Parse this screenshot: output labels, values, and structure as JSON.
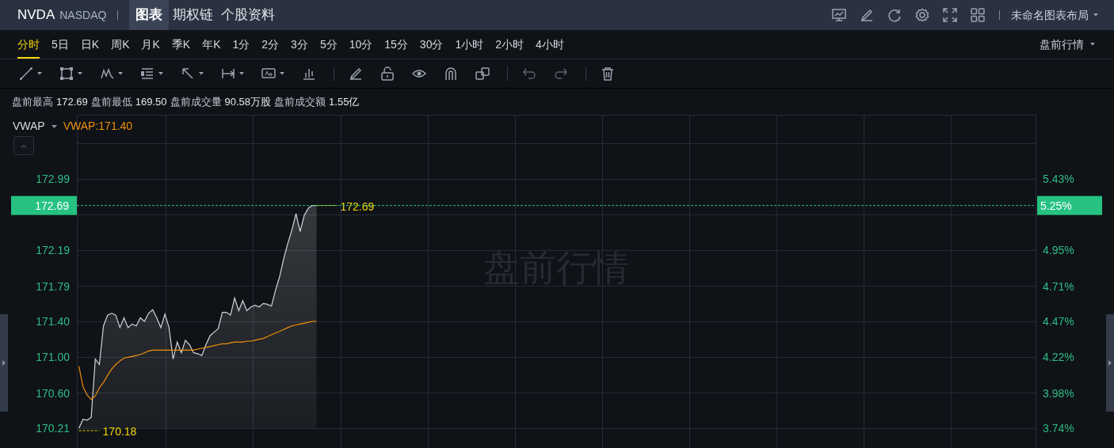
{
  "header": {
    "symbol": "NVDA",
    "exchange": "NASDAQ",
    "tabs": [
      {
        "label": "图表",
        "selected": true
      },
      {
        "label": "期权链",
        "selected": false
      },
      {
        "label": "个股资料",
        "selected": false
      }
    ],
    "layout_menu": "未命名图表布局"
  },
  "periods": [
    {
      "label": "分时",
      "selected": true
    },
    {
      "label": "5日",
      "selected": false
    },
    {
      "label": "日K",
      "selected": false
    },
    {
      "label": "周K",
      "selected": false
    },
    {
      "label": "月K",
      "selected": false
    },
    {
      "label": "季K",
      "selected": false
    },
    {
      "label": "年K",
      "selected": false
    },
    {
      "label": "1分",
      "selected": false
    },
    {
      "label": "2分",
      "selected": false
    },
    {
      "label": "3分",
      "selected": false
    },
    {
      "label": "5分",
      "selected": false
    },
    {
      "label": "10分",
      "selected": false
    },
    {
      "label": "15分",
      "selected": false
    },
    {
      "label": "30分",
      "selected": false
    },
    {
      "label": "1小时",
      "selected": false
    },
    {
      "label": "2小时",
      "selected": false
    },
    {
      "label": "4小时",
      "selected": false
    }
  ],
  "session_menu": "盘前行情",
  "stats": [
    {
      "label": "盘前最高",
      "value": "172.69"
    },
    {
      "label": "盘前最低",
      "value": "169.50"
    },
    {
      "label": "盘前成交量",
      "value": "90.58万股"
    },
    {
      "label": "盘前成交额",
      "value": "1.55亿"
    }
  ],
  "indicator": {
    "name": "VWAP",
    "reading": "VWAP:171.40"
  },
  "chart": {
    "watermark": "盘前行情",
    "current_change": "5.25%",
    "right_axis_labels": [
      "5.43%",
      "4.95%",
      "4.71%",
      "4.47%",
      "4.22%",
      "3.98%",
      "3.74%"
    ],
    "chart_data": {
      "type": "line",
      "grid": true,
      "ylim": [
        169.99,
        173.7
      ],
      "yticks": [
        {
          "value": 172.99,
          "label": "172.99"
        },
        {
          "value": 172.19,
          "label": "172.19"
        },
        {
          "value": 171.79,
          "label": "171.79"
        },
        {
          "value": 171.4,
          "label": "171.40"
        },
        {
          "value": 171.0,
          "label": "171.00"
        },
        {
          "value": 170.6,
          "label": "170.60"
        },
        {
          "value": 170.21,
          "label": "170.21"
        }
      ],
      "ref_lines": [
        {
          "axis": "y",
          "value": 172.69,
          "label": "172.69",
          "color": "#26c281"
        }
      ],
      "series": [
        {
          "type": "area",
          "color": "#d0d4da",
          "values": [
            170.21,
            170.31,
            170.3,
            170.33,
            170.98,
            170.92,
            171.35,
            171.47,
            171.49,
            171.47,
            171.33,
            171.44,
            171.33,
            171.37,
            171.35,
            171.44,
            171.4,
            171.49,
            171.53,
            171.44,
            171.33,
            171.48,
            171.33,
            170.98,
            171.17,
            171.05,
            171.19,
            171.14,
            171.05,
            171.04,
            171.02,
            171.14,
            171.24,
            171.28,
            171.32,
            171.5,
            171.5,
            171.47,
            171.66,
            171.52,
            171.63,
            171.52,
            171.56,
            171.58,
            171.56,
            171.6,
            171.59,
            171.57,
            171.75,
            171.9,
            172.1,
            172.27,
            172.42,
            172.6,
            172.4,
            172.58,
            172.66,
            172.69,
            172.69,
            null,
            null,
            null,
            null,
            null,
            null,
            null,
            null,
            null,
            null,
            null,
            null,
            null,
            null,
            null,
            null,
            null,
            null,
            null,
            null,
            null,
            null,
            null,
            null,
            null,
            null,
            null,
            null,
            null,
            null,
            null,
            null,
            null,
            null,
            null,
            null,
            null,
            null,
            null,
            null,
            null,
            null,
            null,
            null,
            null,
            null,
            null,
            null,
            null,
            null,
            null,
            null,
            null,
            null,
            null,
            null,
            null,
            null,
            null,
            null,
            null,
            null,
            null,
            null,
            null,
            null,
            null,
            null,
            null,
            null,
            null,
            null,
            null,
            null,
            null,
            null,
            null,
            null,
            null,
            null,
            null,
            null,
            null,
            null,
            null,
            null,
            null,
            null,
            null,
            null,
            null,
            null,
            null,
            null,
            null,
            null,
            null,
            null,
            null,
            null,
            null,
            null,
            null,
            null,
            null,
            null,
            null,
            null,
            null,
            null,
            null,
            null,
            null,
            null,
            null,
            null,
            null,
            null,
            null,
            null,
            null,
            null,
            null,
            null,
            null,
            null,
            null,
            null,
            null,
            null,
            null,
            null,
            null,
            null,
            null,
            null,
            null,
            null,
            null,
            null,
            null,
            null,
            null,
            null,
            null,
            null,
            null,
            null,
            null,
            null,
            null,
            null,
            null,
            null,
            null,
            null,
            null,
            null,
            null,
            null,
            null,
            null,
            null,
            null,
            null,
            null,
            null,
            null,
            null,
            null,
            null,
            null,
            null,
            null,
            null
          ]
        },
        {
          "color": "#f0900a",
          "values": [
            170.9,
            170.67,
            170.58,
            170.53,
            170.57,
            170.66,
            170.72,
            170.8,
            170.87,
            170.92,
            170.96,
            170.99,
            171.0,
            171.01,
            171.02,
            171.03,
            171.05,
            171.07,
            171.08,
            171.08,
            171.08,
            171.08,
            171.08,
            171.08,
            171.08,
            171.08,
            171.08,
            171.08,
            171.08,
            171.09,
            171.1,
            171.11,
            171.12,
            171.13,
            171.14,
            171.15,
            171.15,
            171.16,
            171.17,
            171.17,
            171.17,
            171.18,
            171.18,
            171.19,
            171.2,
            171.21,
            171.23,
            171.25,
            171.27,
            171.29,
            171.31,
            171.33,
            171.35,
            171.36,
            171.37,
            171.38,
            171.39,
            171.4,
            171.4,
            null,
            null,
            null,
            null,
            null,
            null,
            null,
            null,
            null,
            null,
            null,
            null,
            null,
            null,
            null,
            null,
            null,
            null,
            null,
            null,
            null,
            null,
            null,
            null,
            null,
            null,
            null,
            null,
            null,
            null,
            null,
            null,
            null,
            null,
            null,
            null,
            null,
            null,
            null,
            null,
            null,
            null,
            null,
            null,
            null,
            null,
            null,
            null,
            null,
            null,
            null,
            null,
            null,
            null,
            null,
            null,
            null,
            null,
            null,
            null,
            null,
            null,
            null,
            null,
            null,
            null,
            null,
            null,
            null,
            null,
            null,
            null,
            null,
            null,
            null,
            null,
            null,
            null,
            null,
            null,
            null,
            null,
            null,
            null,
            null,
            null,
            null,
            null,
            null,
            null,
            null,
            null,
            null,
            null,
            null,
            null,
            null,
            null,
            null,
            null,
            null,
            null,
            null,
            null,
            null,
            null,
            null,
            null,
            null,
            null,
            null,
            null,
            null,
            null,
            null,
            null,
            null,
            null,
            null,
            null,
            null,
            null,
            null,
            null,
            null,
            null,
            null,
            null,
            null,
            null,
            null,
            null,
            null,
            null,
            null,
            null,
            null,
            null,
            null,
            null,
            null,
            null,
            null,
            null,
            null,
            null,
            null,
            null,
            null,
            null,
            null,
            null,
            null,
            null,
            null,
            null,
            null,
            null,
            null,
            null,
            null,
            null,
            null,
            null,
            null,
            null,
            null,
            null,
            null,
            null,
            null,
            null,
            null,
            null,
            null
          ]
        }
      ],
      "annotations": [
        "172.69",
        "170.18"
      ]
    }
  }
}
